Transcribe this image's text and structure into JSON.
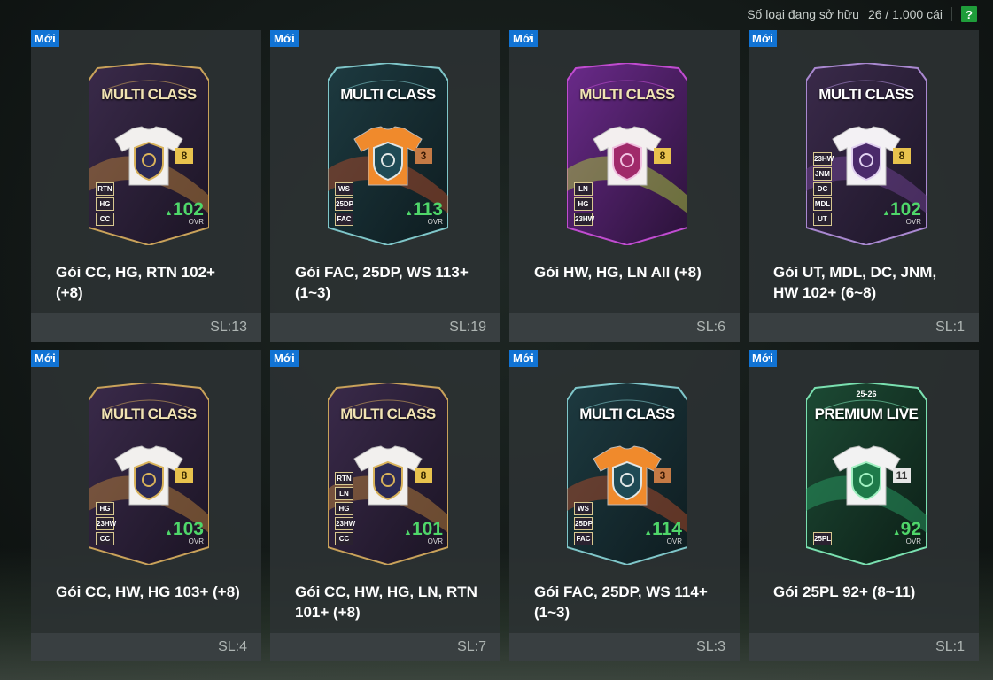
{
  "header": {
    "owned_label": "Số loại đang sở hữu",
    "owned_count": "26 / 1.000 cái",
    "help_label": "?"
  },
  "colors": {
    "new_badge": "#1173d4",
    "ovr_green": "#4fd66a",
    "help_green": "#1f9d3a"
  },
  "packs": [
    {
      "badge": "Mới",
      "card_title": "MULTI CLASS",
      "level": "8",
      "tags": [
        "RTN",
        "HG",
        "CC"
      ],
      "ovr": "102",
      "ovr_label": "OVR",
      "name": "Gói CC, HG, RTN 102+ (+8)",
      "qty": "SL:13",
      "style": "gold"
    },
    {
      "badge": "Mới",
      "card_title": "MULTI CLASS",
      "level": "3",
      "tags": [
        "WS",
        "25DP",
        "FAC"
      ],
      "ovr": "113",
      "ovr_label": "OVR",
      "name": "Gói FAC, 25DP, WS 113+ (1~3)",
      "qty": "SL:19",
      "style": "orange"
    },
    {
      "badge": "Mới",
      "card_title": "MULTI CLASS",
      "level": "8",
      "tags": [
        "LN",
        "HG",
        "23HW"
      ],
      "ovr": "",
      "ovr_label": "",
      "name": "Gói HW, HG, LN All (+8)",
      "qty": "SL:6",
      "style": "purple"
    },
    {
      "badge": "Mới",
      "card_title": "MULTI CLASS",
      "level": "8",
      "tags": [
        "23HW",
        "JNM",
        "DC",
        "MDL",
        "UT"
      ],
      "ovr": "102",
      "ovr_label": "OVR",
      "name": "Gói UT, MDL, DC, JNM, HW 102+ (6~8)",
      "qty": "SL:1",
      "style": "ut"
    },
    {
      "badge": "Mới",
      "card_title": "MULTI CLASS",
      "level": "8",
      "tags": [
        "HG",
        "23HW",
        "CC"
      ],
      "ovr": "103",
      "ovr_label": "OVR",
      "name": "Gói CC, HW, HG 103+ (+8)",
      "qty": "SL:4",
      "style": "gold"
    },
    {
      "badge": "Mới",
      "card_title": "MULTI CLASS",
      "level": "8",
      "tags": [
        "RTN",
        "LN",
        "HG",
        "23HW",
        "CC"
      ],
      "ovr": "101",
      "ovr_label": "OVR",
      "name": "Gói CC, HW, HG, LN, RTN 101+ (+8)",
      "qty": "SL:7",
      "style": "gold"
    },
    {
      "badge": "Mới",
      "card_title": "MULTI CLASS",
      "level": "3",
      "tags": [
        "WS",
        "25DP",
        "FAC"
      ],
      "ovr": "114",
      "ovr_label": "OVR",
      "name": "Gói FAC, 25DP, WS 114+ (1~3)",
      "qty": "SL:3",
      "style": "orange"
    },
    {
      "badge": "Mới",
      "card_title": "PREMIUM LIVE",
      "season": "25-26",
      "level": "11",
      "tags": [
        "25PL"
      ],
      "ovr": "92",
      "ovr_label": "OVR",
      "name": "Gói 25PL 92+ (8~11)",
      "qty": "SL:1",
      "style": "live"
    }
  ]
}
